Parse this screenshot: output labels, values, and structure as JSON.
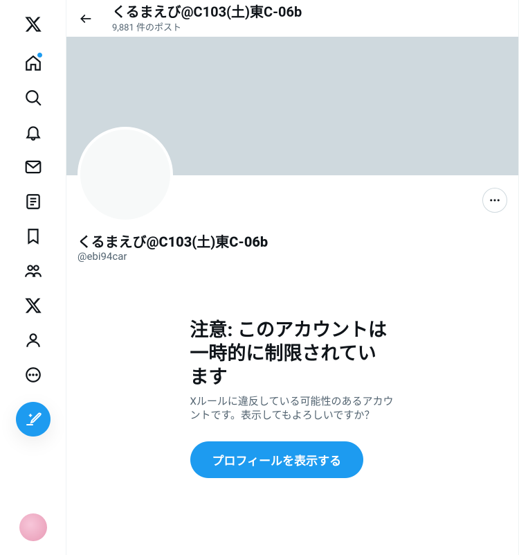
{
  "topbar": {
    "title": "くるまえび@C103(土)東C-06b",
    "post_count": "9,881 件のポスト"
  },
  "profile": {
    "display_name": "くるまえび@C103(土)東C-06b",
    "handle": "@ebi94car"
  },
  "warning": {
    "title": "注意: このアカウントは一時的に制限されています",
    "body": "Xルールに違反している可能性のあるアカウントです。表示してもよろしいですか？",
    "button": "プロフィールを表示する"
  },
  "nav": {
    "logo": "x-logo",
    "home": "home-icon",
    "explore": "search-icon",
    "notifications": "bell-icon",
    "messages": "mail-icon",
    "lists": "list-icon",
    "bookmarks": "bookmark-icon",
    "communities": "communities-icon",
    "premium": "x-icon",
    "profile": "profile-icon",
    "more": "more-circle-icon",
    "compose": "compose-icon"
  }
}
